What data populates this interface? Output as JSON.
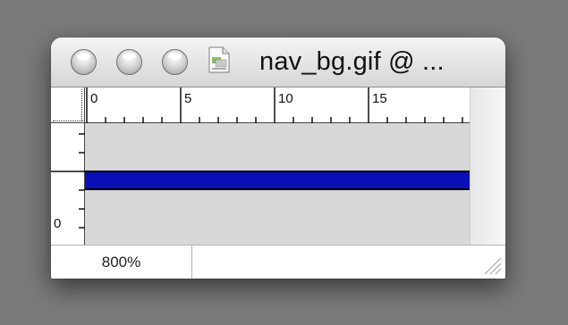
{
  "window": {
    "title": "nav_bg.gif @ ...",
    "file_icon": "gif-document-icon"
  },
  "rulers": {
    "horizontal_labels": [
      "0",
      "5",
      "10",
      "15"
    ],
    "vertical_label": "0"
  },
  "canvas": {
    "background_color": "#d8d8d8",
    "stripe_color": "#0a10b5"
  },
  "status": {
    "zoom": "800%"
  }
}
